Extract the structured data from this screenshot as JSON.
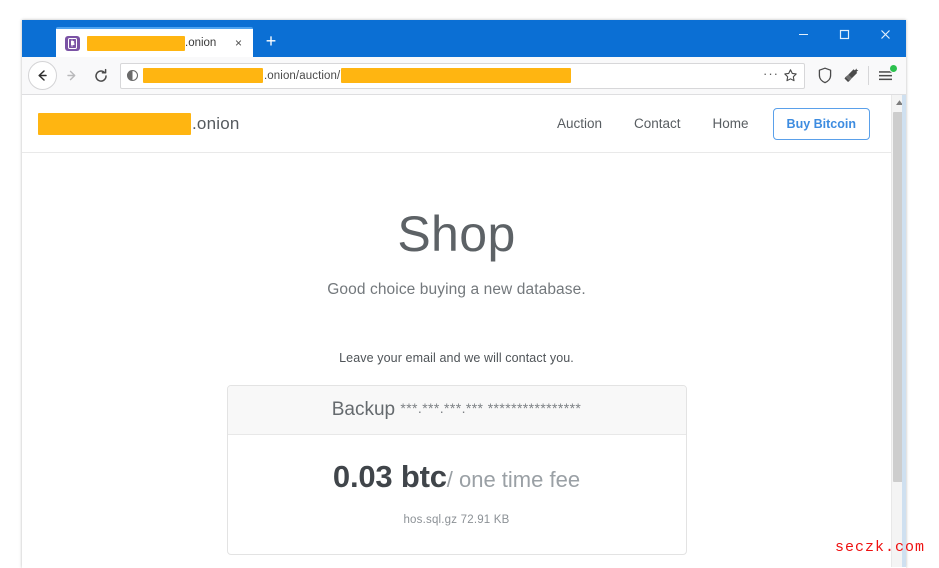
{
  "browser": {
    "tab": {
      "favicon_name": "bitcoin-b-favicon",
      "redacted_title_prefix": "",
      "title_suffix": ".onion",
      "close_label": "×"
    },
    "new_tab_label": "+",
    "window_controls": {
      "minimize_name": "minimize-button",
      "maximize_name": "maximize-button",
      "close_name": "close-button"
    },
    "toolbar": {
      "back_name": "back-button",
      "forward_name": "forward-button",
      "reload_name": "reload-button",
      "identity_name": "site-identity-icon",
      "page_actions_label": "···",
      "bookmark_name": "bookmark-star-icon",
      "shield_name": "tracking-protection-shield-icon",
      "cleaner_name": "cleaner-brush-icon",
      "menu_name": "app-menu-icon"
    },
    "url": {
      "redacted_host": "",
      "visible_path": ".onion/auction/",
      "redacted_tail": ""
    }
  },
  "site": {
    "logo": {
      "redacted_name": "",
      "tld": ".onion"
    },
    "nav": [
      {
        "label": "Auction"
      },
      {
        "label": "Contact"
      },
      {
        "label": "Home"
      }
    ],
    "cta": {
      "label": "Buy Bitcoin"
    }
  },
  "page": {
    "title": "Shop",
    "subtitle": "Good choice buying a new database.",
    "email_note": "Leave your email and we will contact you.",
    "card": {
      "header_label": "Backup",
      "header_mask": "***.***.***.*** ****************",
      "price_amount": "0.03 btc",
      "price_suffix": "/ one time fee",
      "file_info": "hos.sql.gz 72.91 KB"
    }
  },
  "scrollbar": {
    "up_arrow_name": "scroll-up-arrow"
  },
  "watermark": {
    "text": "seczk.com"
  },
  "colors": {
    "titlebar_blue": "#0b6fd4",
    "redaction_orange": "#ffb511",
    "accent_link_blue": "#3d8ce0",
    "watermark_red": "#ee1111",
    "badge_green": "#2cc14e"
  }
}
